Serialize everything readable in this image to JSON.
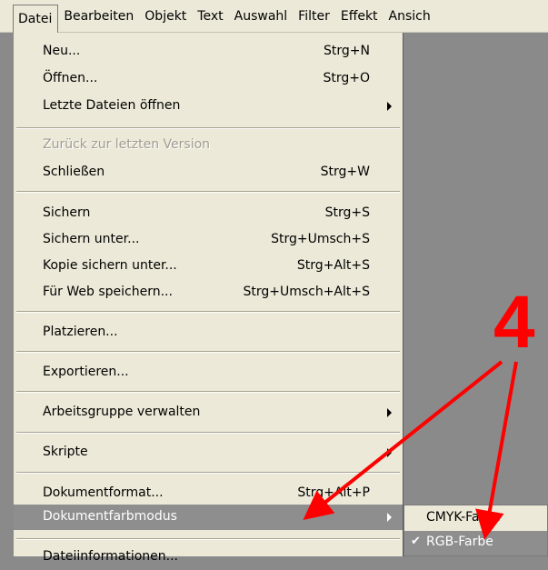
{
  "menubar": {
    "items": [
      "Datei",
      "Bearbeiten",
      "Objekt",
      "Text",
      "Auswahl",
      "Filter",
      "Effekt",
      "Ansich"
    ]
  },
  "menu": {
    "items": [
      {
        "label": "Neu...",
        "shortcut": "Strg+N"
      },
      {
        "label": "Öffnen...",
        "shortcut": "Strg+O"
      },
      {
        "label": "Letzte Dateien öffnen",
        "shortcut": ""
      },
      {
        "label": "Zurück zur letzten Version",
        "shortcut": ""
      },
      {
        "label": "Schließen",
        "shortcut": "Strg+W"
      },
      {
        "label": "Sichern",
        "shortcut": "Strg+S"
      },
      {
        "label": "Sichern unter...",
        "shortcut": "Strg+Umsch+S"
      },
      {
        "label": "Kopie sichern unter...",
        "shortcut": "Strg+Alt+S"
      },
      {
        "label": "Für Web speichern...",
        "shortcut": "Strg+Umsch+Alt+S"
      },
      {
        "label": "Platzieren...",
        "shortcut": ""
      },
      {
        "label": "Exportieren...",
        "shortcut": ""
      },
      {
        "label": "Arbeitsgruppe verwalten",
        "shortcut": ""
      },
      {
        "label": "Skripte",
        "shortcut": ""
      },
      {
        "label": "Dokumentformat...",
        "shortcut": "Strg+Alt+P"
      },
      {
        "label": "Dokumentfarbmodus",
        "shortcut": ""
      },
      {
        "label": "Dateiinformationen...",
        "shortcut": ""
      }
    ]
  },
  "submenu": {
    "items": [
      {
        "label": "CMYK-Farbe"
      },
      {
        "label": "RGB-Farbe",
        "check": "✔"
      }
    ]
  },
  "annotation": {
    "number": "4",
    "color": "#ff0000"
  }
}
